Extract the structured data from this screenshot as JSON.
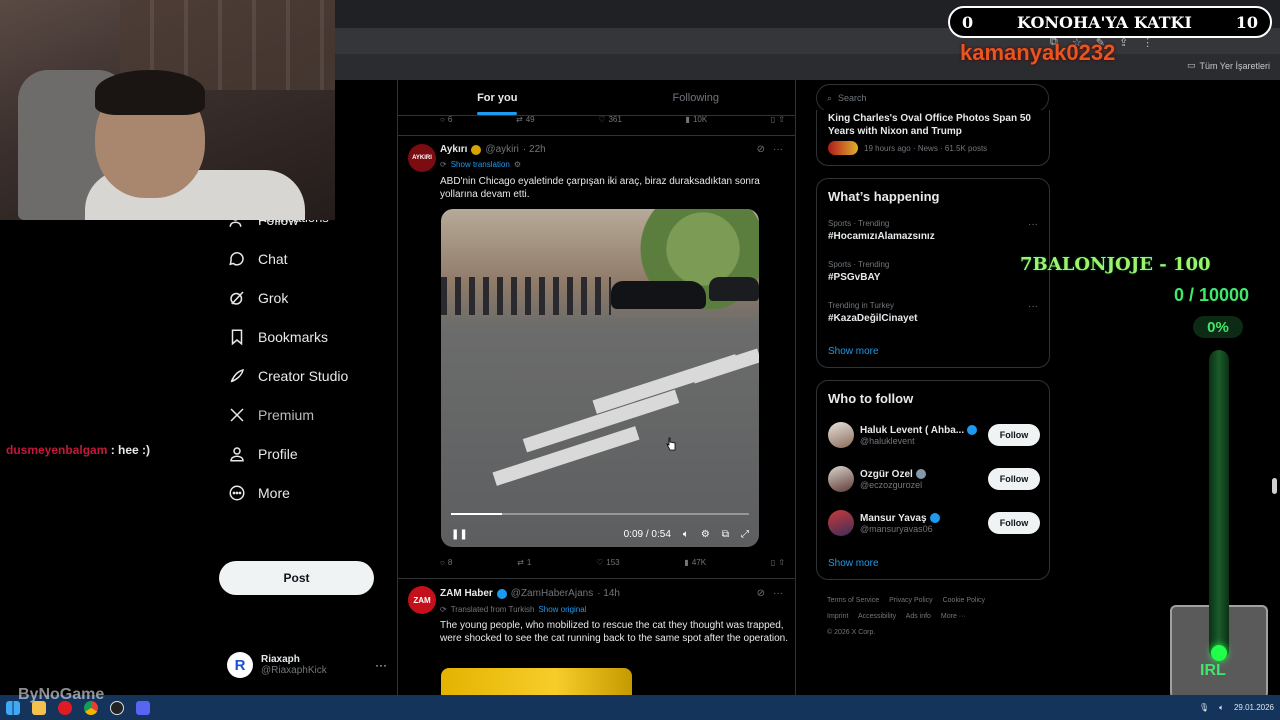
{
  "overlay": {
    "counter_left": "0",
    "counter_title": "KONOHA'YA KATKI",
    "counter_right": "10",
    "username": "kamanyak0232",
    "goal_title": "7BALONJOJE - 100",
    "goal_count": "0 / 10000",
    "goal_percent": "0%",
    "goal_progress": 0,
    "irl_label": "IRL",
    "watermark": "ByNoGame"
  },
  "chat": {
    "user": "dusmeyenbalgam",
    "message": ": hee :)"
  },
  "browser": {
    "bookmarks_all": "Tüm Yer İşaretleri"
  },
  "nav": {
    "partial_item": "Notifications",
    "items": [
      {
        "label": "Follow",
        "icon": "follow-icon"
      },
      {
        "label": "Chat",
        "icon": "chat-icon"
      },
      {
        "label": "Grok",
        "icon": "grok-icon"
      },
      {
        "label": "Bookmarks",
        "icon": "bookmark-icon"
      },
      {
        "label": "Creator Studio",
        "icon": "rocket-icon"
      },
      {
        "label": "Premium",
        "icon": "x-logo-icon"
      },
      {
        "label": "Profile",
        "icon": "profile-icon"
      },
      {
        "label": "More",
        "icon": "more-circle-icon"
      }
    ],
    "post_label": "Post",
    "account": {
      "name": "Riaxaph",
      "handle": "@RiaxaphKick",
      "avatar_letter": "R"
    }
  },
  "feed": {
    "tabs": [
      {
        "label": "For you",
        "active": true
      },
      {
        "label": "Following",
        "active": false
      }
    ],
    "prev_actions": {
      "replies": "6",
      "reposts": "49",
      "likes": "361",
      "views": "10K"
    },
    "tweets": [
      {
        "name": "Aykırı",
        "handle": "@aykiri",
        "time": "· 22h",
        "avatar_text": "AYKIRI",
        "sub": "Show translation",
        "text": "ABD'nin Chicago eyaletinde çarpışan iki araç, biraz duraksadıktan sonra yollarına devam etti.",
        "video_time": "0:09 / 0:54",
        "video_progress": 0.17,
        "replies": "8",
        "reposts": "1",
        "likes": "153",
        "views": "47K"
      },
      {
        "name": "ZAM Haber",
        "handle": "@ZamHaberAjans",
        "time": "· 14h",
        "avatar_text": "ZAM",
        "sub_prefix": "Translated from Turkish",
        "sub": "Show original",
        "text": "The young people, who mobilized to rescue the cat they thought was trapped, were shocked to see the cat running back to the same spot after the operation."
      }
    ]
  },
  "sidebar": {
    "search_placeholder": "Search",
    "news": {
      "title": "King Charles's Oval Office Photos Span 50 Years with Nixon and Trump",
      "meta": "19 hours ago · News · 61.5K posts"
    },
    "whats_happening": {
      "title": "What’s happening",
      "trends": [
        {
          "category": "Sports · Trending",
          "tag": "#HocamızıAlamazsınız"
        },
        {
          "category": "Sports · Trending",
          "tag": "#PSGvBAY"
        },
        {
          "category": "Trending in Turkey",
          "tag": "#KazaDeğilCinayet"
        }
      ],
      "show_more": "Show more"
    },
    "who_to_follow": {
      "title": "Who to follow",
      "accounts": [
        {
          "name": "Haluk Levent ( Ahba...",
          "handle": "@haluklevent",
          "badge": "blue"
        },
        {
          "name": "Özgür Özel",
          "handle": "@eczozgurozel",
          "badge": "grey"
        },
        {
          "name": "Mansur Yavaş",
          "handle": "@mansuryavas06",
          "badge": "blue"
        }
      ],
      "follow_label": "Follow",
      "show_more": "Show more"
    },
    "footer": {
      "links": [
        "Terms of Service",
        "Privacy Policy",
        "Cookie Policy",
        "Imprint",
        "Accessibility",
        "Ads info",
        "More ···"
      ],
      "copyright": "© 2026 X Corp."
    }
  },
  "taskbar": {
    "date": "29.01.2026"
  },
  "colors": {
    "accent": "#1d9bf0",
    "goal_green": "#3fe86a",
    "username_orange": "#e8551e",
    "chat_user_red": "#c2183b",
    "taskbar": "#14345c"
  }
}
